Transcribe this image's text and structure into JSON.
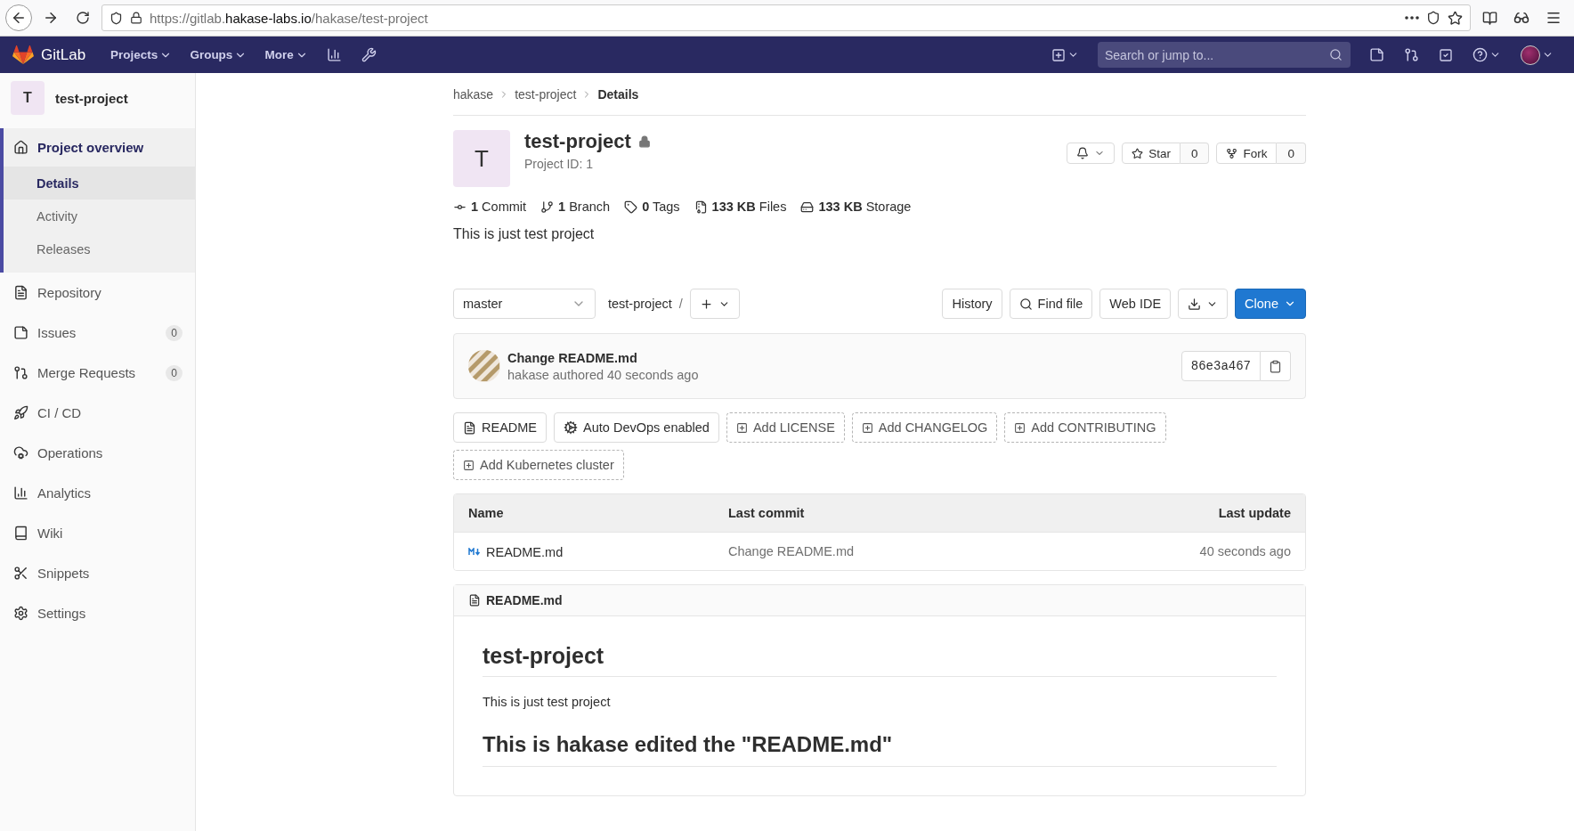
{
  "browser": {
    "url_prefix": "https://gitlab.",
    "url_host": "hakase-labs.io",
    "url_path": "/hakase/test-project"
  },
  "navbar": {
    "brand": "GitLab",
    "menus": [
      "Projects",
      "Groups",
      "More"
    ],
    "search_placeholder": "Search or jump to..."
  },
  "sidebar": {
    "project": {
      "avatar_letter": "T",
      "name": "test-project"
    },
    "items": [
      {
        "label": "Project overview",
        "selected": true,
        "children": [
          {
            "label": "Details",
            "selected": true
          },
          {
            "label": "Activity",
            "selected": false
          },
          {
            "label": "Releases",
            "selected": false
          }
        ]
      },
      {
        "label": "Repository",
        "selected": false
      },
      {
        "label": "Issues",
        "selected": false,
        "badge": "0"
      },
      {
        "label": "Merge Requests",
        "selected": false,
        "badge": "0"
      },
      {
        "label": "CI / CD",
        "selected": false
      },
      {
        "label": "Operations",
        "selected": false
      },
      {
        "label": "Analytics",
        "selected": false
      },
      {
        "label": "Wiki",
        "selected": false
      },
      {
        "label": "Snippets",
        "selected": false
      },
      {
        "label": "Settings",
        "selected": false
      }
    ]
  },
  "breadcrumb": [
    {
      "label": "hakase",
      "current": false
    },
    {
      "label": "test-project",
      "current": false
    },
    {
      "label": "Details",
      "current": true
    }
  ],
  "project": {
    "avatar_letter": "T",
    "name": "test-project",
    "id_text": "Project ID: 1",
    "star": {
      "label": "Star",
      "count": "0"
    },
    "fork": {
      "label": "Fork",
      "count": "0"
    },
    "stats": [
      "**1** Commit",
      "**1** Branch",
      "**0** Tags",
      "**133 KB** Files",
      "**133 KB** Storage"
    ],
    "description": "This is just test project"
  },
  "repo": {
    "branch": "master",
    "path": "test-project",
    "separator": "/",
    "buttons": [
      "History",
      "Find file",
      "Web IDE"
    ],
    "clone": "Clone"
  },
  "commit": {
    "title": "Change README.md",
    "meta": "hakase authored 40 seconds ago",
    "sha": "86e3a467"
  },
  "quick_buttons": [
    {
      "label": "README",
      "kind": "existing"
    },
    {
      "label": "Auto DevOps enabled",
      "kind": "existing"
    },
    {
      "label": "Add LICENSE",
      "kind": "add"
    },
    {
      "label": "Add CHANGELOG",
      "kind": "add"
    },
    {
      "label": "Add CONTRIBUTING",
      "kind": "add"
    },
    {
      "label": "Add Kubernetes cluster",
      "kind": "add"
    }
  ],
  "table": {
    "columns": [
      "Name",
      "Last commit",
      "Last update"
    ],
    "rows": [
      {
        "name": "README.md",
        "last_commit": "Change README.md",
        "last_update": "40 seconds ago"
      }
    ]
  },
  "readme": {
    "filename": "README.md",
    "heading": "test-project",
    "paragraph": "This is just test project",
    "heading2": "This is hakase edited the \"README.md\""
  }
}
